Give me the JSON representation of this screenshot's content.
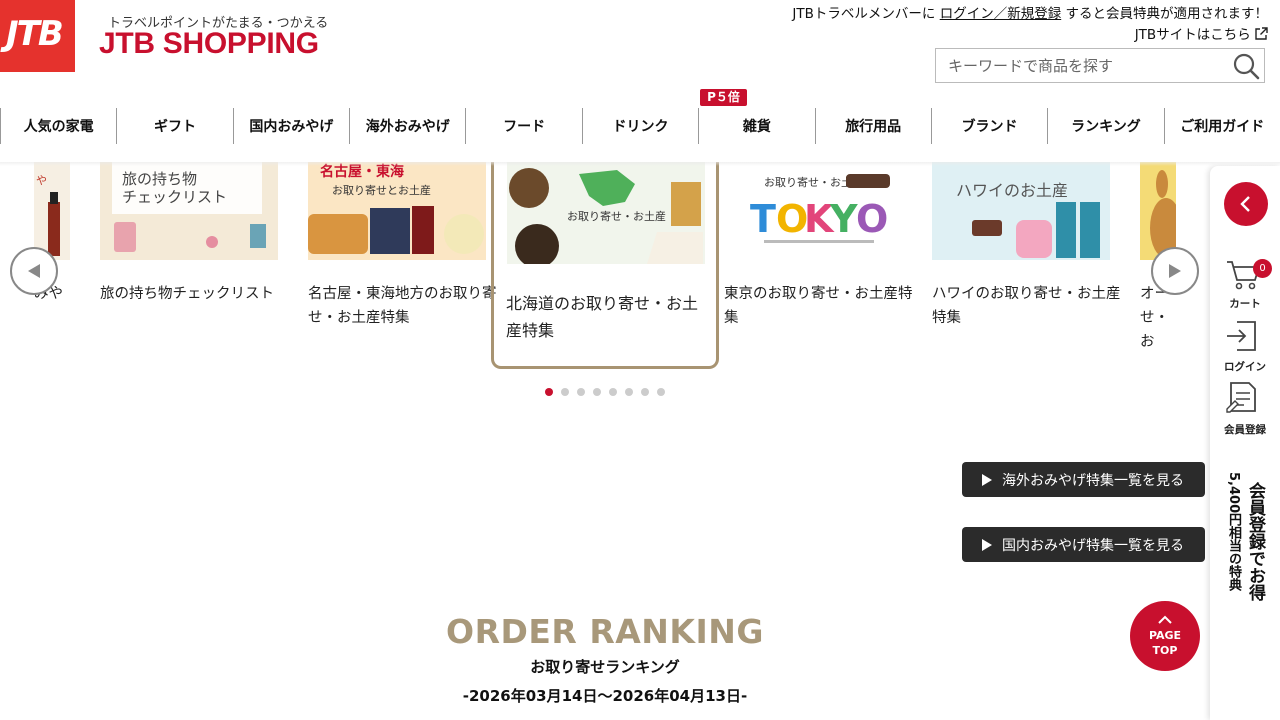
{
  "header": {
    "logo_text": "JTB",
    "tagline": "トラベルポイントがたまる・つかえる",
    "brand_name": "JTB SHOPPING",
    "member_prefix": "JTBトラベルメンバーに",
    "member_link": "ログイン／新規登録",
    "member_suffix": "すると会員特典が適用されます！",
    "jtb_site_link": "JTBサイトはこちら",
    "search_placeholder": "キーワードで商品を探す"
  },
  "nav": {
    "items": [
      "人気の家電",
      "ギフト",
      "国内おみやげ",
      "海外おみやげ",
      "フード",
      "ドリンク",
      "雑貨",
      "旅行用品",
      "ブランド",
      "ランキング",
      "ご利用ガイド"
    ],
    "badge": "P５倍"
  },
  "carousel": {
    "partial_left_caption": "みや",
    "cards": [
      {
        "caption": "旅の持ち物チェックリスト",
        "thumb_text": "旅の持ち物 チェックリスト"
      },
      {
        "caption": "名古屋・東海地方のお取り寄せ・お土産特集",
        "thumb_text": "名古屋・東海 お取り寄せとお土産"
      },
      {
        "caption": "北海道のお取り寄せ・お土産特集",
        "thumb_text": "お取り寄せ・お土産"
      },
      {
        "caption": "東京のお取り寄せ・お土産特集",
        "thumb_text": "TOKYO",
        "thumb_sub": "お取り寄せ・お土産"
      },
      {
        "caption": "ハワイのお取り寄せ・お土産特集",
        "thumb_text": "ハワイのお土産"
      },
      {
        "caption": "オーストラリアのお取り寄せ・お土産特集",
        "caption_visible": "オー\nせ・お"
      }
    ],
    "dots_count": 8,
    "active_dot": 0
  },
  "buttons": {
    "overseas": "海外おみやげ特集一覧を見る",
    "domestic": "国内おみやげ特集一覧を見る"
  },
  "sidebar": {
    "cart_label": "カート",
    "cart_count": "0",
    "login_label": "ログイン",
    "register_label": "会員登録",
    "promo_line1": "会員登録でお得",
    "promo_line2": "5,400円相当の特典"
  },
  "ranking": {
    "title": "ORDER RANKING",
    "subtitle": "お取り寄せランキング",
    "period": "-2026年03月14日～2026年04月13日-"
  },
  "page_top": {
    "line1": "PAGE",
    "line2": "TOP"
  },
  "colors": {
    "brand_red": "#c8102e",
    "accent_gold": "#a8987a",
    "button_dark": "#2b2b2b"
  }
}
